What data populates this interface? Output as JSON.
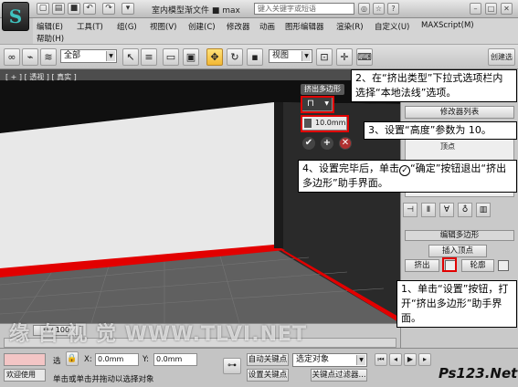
{
  "app": {
    "document_title": "室内模型渐文件 ■ max",
    "search_placeholder": "键入关键字或短语",
    "logo_glyph": "S"
  },
  "menu": {
    "items": [
      "编辑(E)",
      "工具(T)",
      "组(G)",
      "视图(V)",
      "创建(C)",
      "修改器",
      "动画",
      "图形编辑器",
      "渲染(R)",
      "自定义(U)",
      "MAXScript(M)",
      "帮助(H)"
    ]
  },
  "toolbar": {
    "selection_filter": "全部",
    "reference_coord": "视图",
    "create_selection": "创建选"
  },
  "viewport": {
    "label": "[ + ] [ 透视 ] [ 真实 ]"
  },
  "caddy": {
    "title": "挤出多边形",
    "height_value": "10.0mm",
    "type_glyph": "⊓",
    "ok_glyph": "✔",
    "apply_glyph": "+",
    "cancel_glyph": "✕"
  },
  "command_panel": {
    "rollout_title": "编辑多边形",
    "insert_vertex": "插入顶点",
    "extrude": "挤出",
    "outline": "轮廓",
    "modifier_list_label": "修改器列表",
    "stack_item": "顶点"
  },
  "callouts": {
    "step1": "1、单击“设置”按钮，打开“挤出多边形”助手界面。",
    "step2": "2、在“挤出类型”下拉式选项栏内选择“本地法线”选项。",
    "step3": "3、设置“高度”参数为 10。",
    "step4_a": "4、设置完毕后，单击",
    "step4_b": "“确定”按钮退出“挤出多边形”助手界面。"
  },
  "timeline": {
    "frame_range": "0 / 100"
  },
  "status": {
    "welcome": "欢迎使用",
    "prompt": "单击或单击并拖动以选择对象",
    "select_label": "选",
    "x_label": "X:",
    "x_value": "0.0mm",
    "y_label": "Y:",
    "y_value": "0.0mm",
    "auto_key": "自动关键点",
    "set_key": "设置关键点",
    "selected_object": "选定对象",
    "key_filters": "关键点过滤器..."
  },
  "watermark": {
    "text": "缘 自 视 觉   WWW.TLVI.NET",
    "site_logo": "Ps123.Net"
  },
  "colors": {
    "highlight_red": "#e20000",
    "viewport_bg": "#4d4d4d",
    "accent_yellow": "#f2b733"
  }
}
